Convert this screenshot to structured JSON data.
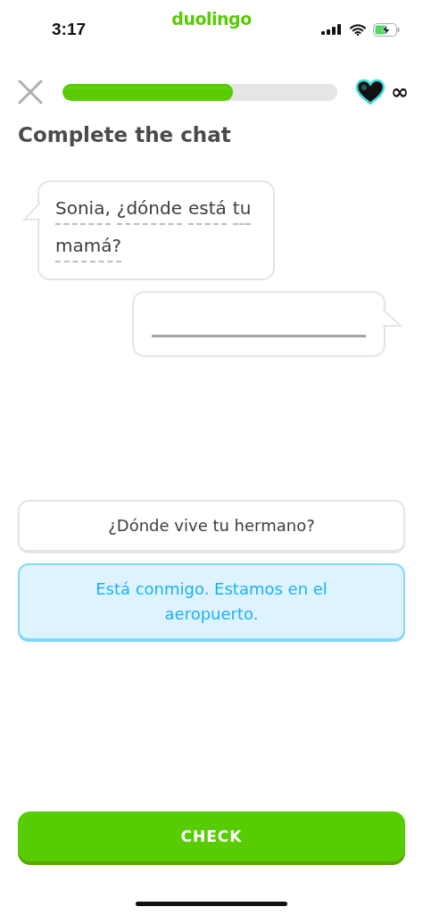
{
  "status_bar": {
    "time": "3:17",
    "app": "duolingo"
  },
  "header": {
    "progress": {
      "level": 0.62
    },
    "hearts": "∞"
  },
  "title": "Complete the chat",
  "chat": {
    "prompt_words": [
      "Sonia,",
      "¿dónde",
      "está",
      "tu",
      "mamá?"
    ]
  },
  "options": [
    {
      "text": "¿Dónde vive tu hermano?",
      "selected": false
    },
    {
      "text": "Está conmigo. Estamos en el aeropuerto.",
      "selected": true
    }
  ],
  "check_button": "CHECK"
}
